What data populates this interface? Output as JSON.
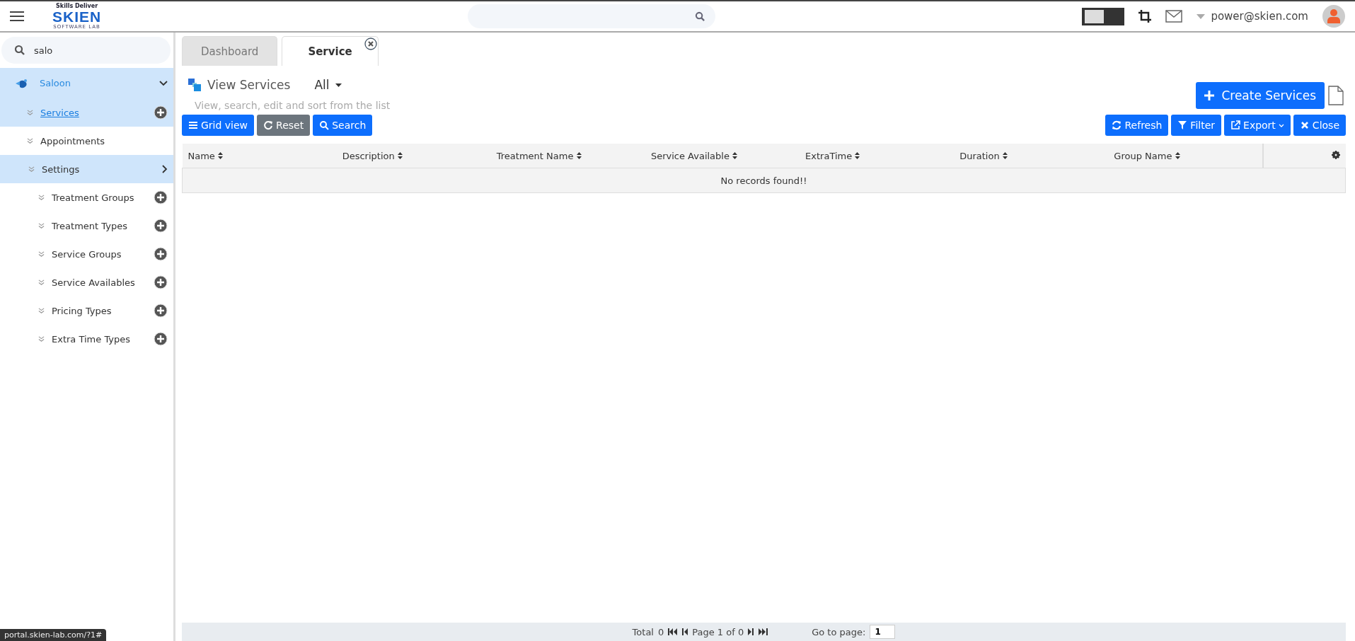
{
  "header": {
    "logo": {
      "tagline": "Skills Deliver",
      "name": "SKIEN",
      "subtitle": "SOFTWARE LAB"
    },
    "toggle": {
      "on": false
    },
    "user": "power@skien.com"
  },
  "sidebar": {
    "search": {
      "value": "salo"
    },
    "items": [
      {
        "kind": "module",
        "label": "Saloon",
        "selected": true,
        "expanded": true,
        "add": false
      },
      {
        "kind": "item",
        "label": "Services",
        "selected": true,
        "add": true
      },
      {
        "kind": "item",
        "label": "Appointments",
        "selected": false,
        "add": false
      },
      {
        "kind": "section",
        "label": "Settings",
        "selected": true,
        "expanded": false,
        "add": false
      },
      {
        "kind": "child",
        "label": "Treatment Groups",
        "selected": false,
        "add": true
      },
      {
        "kind": "child",
        "label": "Treatment Types",
        "selected": false,
        "add": true
      },
      {
        "kind": "child",
        "label": "Service Groups",
        "selected": false,
        "add": true
      },
      {
        "kind": "child",
        "label": "Service Availables",
        "selected": false,
        "add": true
      },
      {
        "kind": "child",
        "label": "Pricing Types",
        "selected": false,
        "add": true
      },
      {
        "kind": "child",
        "label": "Extra Time Types",
        "selected": false,
        "add": true
      }
    ]
  },
  "tabs": [
    {
      "label": "Dashboard",
      "selected": false,
      "closable": false
    },
    {
      "label": "Service",
      "selected": true,
      "closable": true
    }
  ],
  "page": {
    "title": "View Services",
    "filter": "All",
    "subtitle": "View, search, edit and sort from the list",
    "create_button": "Create Services"
  },
  "toolbar_left": [
    {
      "kind": "grid",
      "label": "Grid view"
    },
    {
      "kind": "reset",
      "label": "Reset"
    },
    {
      "kind": "search",
      "label": "Search"
    }
  ],
  "toolbar_right": [
    {
      "kind": "refresh",
      "label": "Refresh"
    },
    {
      "kind": "filter",
      "label": "Filter"
    },
    {
      "kind": "export",
      "label": "Export"
    },
    {
      "kind": "close",
      "label": "Close"
    }
  ],
  "table": {
    "columns": [
      "Name",
      "Description",
      "Treatment Name",
      "Service Available",
      "ExtraTime",
      "Duration",
      "Group Name"
    ],
    "empty_message": "No records found!!"
  },
  "pager": {
    "total_label": "Total",
    "total": "0",
    "page_text": "Page 1 of 0",
    "goto_label": "Go to page:",
    "page_value": "1"
  },
  "status_url": "portal.skien-lab.com/?1#"
}
